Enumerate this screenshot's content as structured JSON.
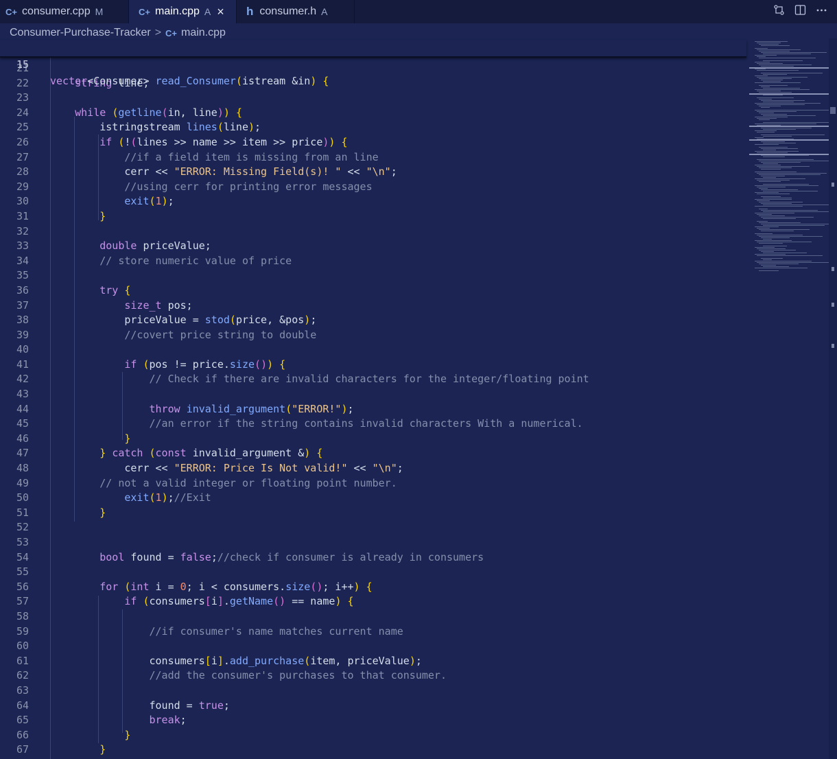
{
  "tabs": [
    {
      "label": "consumer.cpp",
      "badge": "M",
      "icon": "cpp-file-icon",
      "active": false
    },
    {
      "label": "main.cpp",
      "badge": "A",
      "icon": "cpp-file-icon",
      "active": true,
      "close": "×"
    },
    {
      "label": "consumer.h",
      "badge": "A",
      "icon": "h-file-icon",
      "active": false
    }
  ],
  "toolbar": {
    "compare_icon": "compare-changes-icon",
    "split_icon": "split-editor-icon",
    "more_icon": "more-actions-icon"
  },
  "breadcrumb": {
    "folder": "Consumer-Purchase-Tracker",
    "separator": ">",
    "file": "main.cpp"
  },
  "sticky_header": {
    "line_number": "15",
    "code": "vector<Consumer> read_Consumer(istream &in) {"
  },
  "editor": {
    "lines": [
      {
        "n": "21",
        "code": ""
      },
      {
        "n": "22",
        "code": "    string line;"
      },
      {
        "n": "23",
        "code": ""
      },
      {
        "n": "24",
        "code": "    while (getline(in, line)) {"
      },
      {
        "n": "25",
        "code": "        istringstream lines(line);"
      },
      {
        "n": "26",
        "code": "        if (!(lines >> name >> item >> price)) {"
      },
      {
        "n": "27",
        "code": "            //if a field item is missing from an line"
      },
      {
        "n": "28",
        "code": "            cerr << \"ERROR: Missing Field(s)! \" << \"\\n\";"
      },
      {
        "n": "29",
        "code": "            //using cerr for printing error messages"
      },
      {
        "n": "30",
        "code": "            exit(1);"
      },
      {
        "n": "31",
        "code": "        }"
      },
      {
        "n": "32",
        "code": ""
      },
      {
        "n": "33",
        "code": "        double priceValue;"
      },
      {
        "n": "34",
        "code": "        // store numeric value of price"
      },
      {
        "n": "35",
        "code": ""
      },
      {
        "n": "36",
        "code": "        try {"
      },
      {
        "n": "37",
        "code": "            size_t pos;"
      },
      {
        "n": "38",
        "code": "            priceValue = stod(price, &pos);"
      },
      {
        "n": "39",
        "code": "            //covert price string to double"
      },
      {
        "n": "40",
        "code": ""
      },
      {
        "n": "41",
        "code": "            if (pos != price.size()) {"
      },
      {
        "n": "42",
        "code": "                // Check if there are invalid characters for the integer/floating point"
      },
      {
        "n": "43",
        "code": ""
      },
      {
        "n": "44",
        "code": "                throw invalid_argument(\"ERROR!\");"
      },
      {
        "n": "45",
        "code": "                //an error if the string contains invalid characters With a numerical."
      },
      {
        "n": "46",
        "code": "            }"
      },
      {
        "n": "47",
        "code": "        } catch (const invalid_argument &) {"
      },
      {
        "n": "48",
        "code": "            cerr << \"ERROR: Price Is Not valid!\" << \"\\n\";"
      },
      {
        "n": "49",
        "code": "        // not a valid integer or floating point number."
      },
      {
        "n": "50",
        "code": "            exit(1);//Exit"
      },
      {
        "n": "51",
        "code": "        }"
      },
      {
        "n": "52",
        "code": ""
      },
      {
        "n": "53",
        "code": ""
      },
      {
        "n": "54",
        "code": "        bool found = false;//check if consumer is already in consumers"
      },
      {
        "n": "55",
        "code": ""
      },
      {
        "n": "56",
        "code": "        for (int i = 0; i < consumers.size(); i++) {"
      },
      {
        "n": "57",
        "code": "            if (consumers[i].getName() == name) {"
      },
      {
        "n": "58",
        "code": ""
      },
      {
        "n": "59",
        "code": "                //if consumer's name matches current name"
      },
      {
        "n": "60",
        "code": ""
      },
      {
        "n": "61",
        "code": "                consumers[i].add_purchase(item, priceValue);"
      },
      {
        "n": "62",
        "code": "                //add the consumer's purchases to that consumer."
      },
      {
        "n": "63",
        "code": ""
      },
      {
        "n": "64",
        "code": "                found = true;"
      },
      {
        "n": "65",
        "code": "                break;"
      },
      {
        "n": "66",
        "code": "            }"
      },
      {
        "n": "67",
        "code": "        }"
      }
    ]
  },
  "colors": {
    "background": "#1b2452",
    "tabbar": "#141b3d",
    "keyword": "#c792ea",
    "function": "#82aaff",
    "string": "#ecc48d",
    "comment": "#8590ad",
    "number": "#f78c6c"
  }
}
